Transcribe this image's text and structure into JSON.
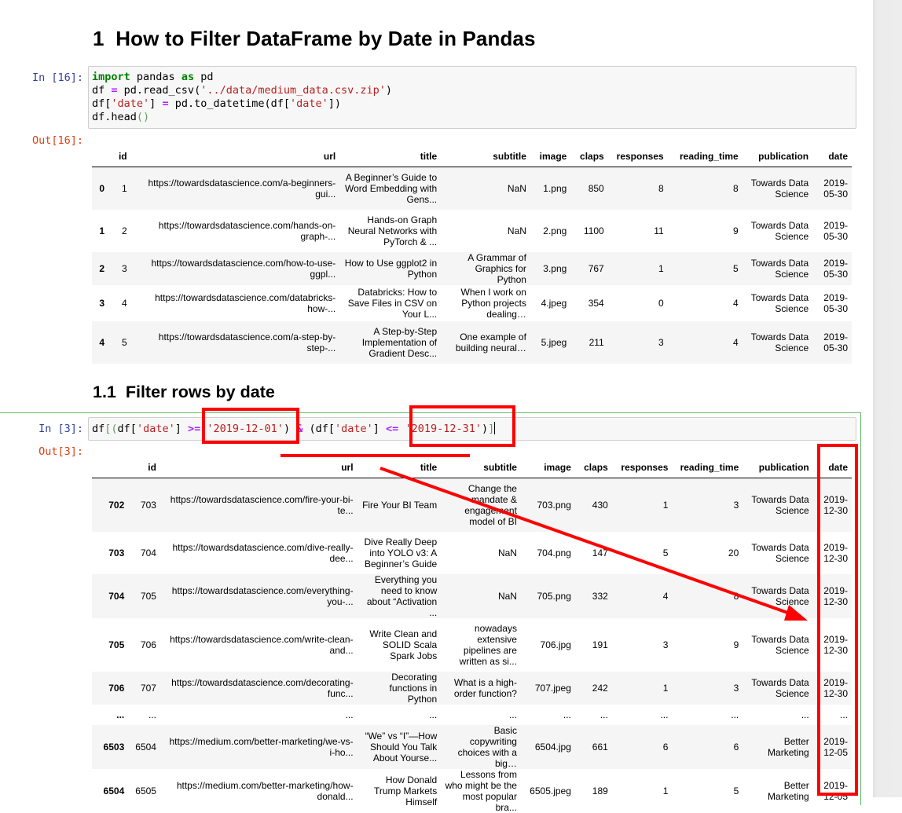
{
  "headings": {
    "h1_number": "1",
    "h1_text": "How to Filter DataFrame by Date in Pandas",
    "h2_number": "1.1",
    "h2_text": "Filter rows by date"
  },
  "cell1": {
    "in_prompt": "In [16]:",
    "out_prompt": "Out[16]:",
    "code": {
      "l1_kw1": "import",
      "l1_mod": " pandas ",
      "l1_kw2": "as",
      "l1_alias": " pd",
      "l2_a": "df ",
      "l2_eq": "=",
      "l2_b": " pd.read_csv(",
      "l2_str": "'../data/medium_data.csv.zip'",
      "l2_c": ")",
      "l3_a": "df[",
      "l3_str1": "'date'",
      "l3_b": "] ",
      "l3_eq": "=",
      "l3_c": " pd.to_datetime(df[",
      "l3_str2": "'date'",
      "l3_d": "])",
      "l4_a": "df.head",
      "l4_paren": "()"
    },
    "table": {
      "columns": [
        "",
        "id",
        "url",
        "title",
        "subtitle",
        "image",
        "claps",
        "responses",
        "reading_time",
        "publication",
        "date"
      ],
      "rows": [
        [
          "0",
          "1",
          "https://towardsdatascience.com/a-beginners-gui...",
          "A Beginner’s Guide to Word Embedding with Gens...",
          "NaN",
          "1.png",
          "850",
          "8",
          "8",
          "Towards Data Science",
          "2019-05-30"
        ],
        [
          "1",
          "2",
          "https://towardsdatascience.com/hands-on-graph-...",
          "Hands-on Graph Neural Networks with PyTorch & ...",
          "NaN",
          "2.png",
          "1100",
          "11",
          "9",
          "Towards Data Science",
          "2019-05-30"
        ],
        [
          "2",
          "3",
          "https://towardsdatascience.com/how-to-use-ggpl...",
          "How to Use ggplot2 in Python",
          "A Grammar of Graphics for Python",
          "3.png",
          "767",
          "1",
          "5",
          "Towards Data Science",
          "2019-05-30"
        ],
        [
          "3",
          "4",
          "https://towardsdatascience.com/databricks-how-...",
          "Databricks: How to Save Files in CSV on Your L...",
          "When I work on Python projects dealing…",
          "4.jpeg",
          "354",
          "0",
          "4",
          "Towards Data Science",
          "2019-05-30"
        ],
        [
          "4",
          "5",
          "https://towardsdatascience.com/a-step-by-step-...",
          "A Step-by-Step Implementation of Gradient Desc...",
          "One example of building neural…",
          "5.jpeg",
          "211",
          "3",
          "4",
          "Towards Data Science",
          "2019-05-30"
        ]
      ]
    }
  },
  "cell2": {
    "in_prompt": "In [3]:",
    "out_prompt": "Out[3]:",
    "code": {
      "a": "df",
      "b1": "[",
      "b2": "(",
      "c": "df[",
      "s1": "'date'",
      "d": "] ",
      "op1": ">=",
      "e": " ",
      "s2": "'2019-12-01'",
      "f": ") ",
      "amp": "&",
      "g": " (df[",
      "s3": "'date'",
      "h": "] ",
      "op2": "<=",
      "i": " ",
      "s4": "'2019-12-31'",
      "j": ")",
      "k": "]"
    },
    "table": {
      "columns": [
        "",
        "id",
        "url",
        "title",
        "subtitle",
        "image",
        "claps",
        "responses",
        "reading_time",
        "publication",
        "date"
      ],
      "rows": [
        [
          "702",
          "703",
          "https://towardsdatascience.com/fire-your-bi-te...",
          "Fire Your BI Team",
          "Change the mandate & engagement model of BI",
          "703.png",
          "430",
          "1",
          "3",
          "Towards Data Science",
          "2019-12-30"
        ],
        [
          "703",
          "704",
          "https://towardsdatascience.com/dive-really-dee...",
          "Dive Really Deep into YOLO v3: A Beginner’s Guide",
          "NaN",
          "704.png",
          "147",
          "5",
          "20",
          "Towards Data Science",
          "2019-12-30"
        ],
        [
          "704",
          "705",
          "https://towardsdatascience.com/everything-you-...",
          "Everything you need to know about “Activation ...",
          "NaN",
          "705.png",
          "332",
          "4",
          "8",
          "Towards Data Science",
          "2019-12-30"
        ],
        [
          "705",
          "706",
          "https://towardsdatascience.com/write-clean-and...",
          "Write Clean and SOLID Scala Spark Jobs",
          "nowadays extensive pipelines are written as si...",
          "706.jpg",
          "191",
          "3",
          "9",
          "Towards Data Science",
          "2019-12-30"
        ],
        [
          "706",
          "707",
          "https://towardsdatascience.com/decorating-func...",
          "Decorating functions in Python",
          "What is a high-order function?",
          "707.jpeg",
          "242",
          "1",
          "3",
          "Towards Data Science",
          "2019-12-30"
        ],
        [
          "...",
          "...",
          "...",
          "...",
          "...",
          "...",
          "...",
          "...",
          "...",
          "...",
          "..."
        ],
        [
          "6503",
          "6504",
          "https://medium.com/better-marketing/we-vs-i-ho...",
          "“We” vs “I”—How Should You Talk About Yourse...",
          "Basic copywriting choices with a big…",
          "6504.jpg",
          "661",
          "6",
          "6",
          "Better Marketing",
          "2019-12-05"
        ],
        [
          "6504",
          "6505",
          "https://medium.com/better-marketing/how-donald...",
          "How Donald Trump Markets Himself",
          "Lessons from who might be the most popular bra...",
          "6505.jpeg",
          "189",
          "1",
          "5",
          "Better Marketing",
          "2019-12-05"
        ]
      ]
    }
  },
  "annotation_color": "#ff0000"
}
